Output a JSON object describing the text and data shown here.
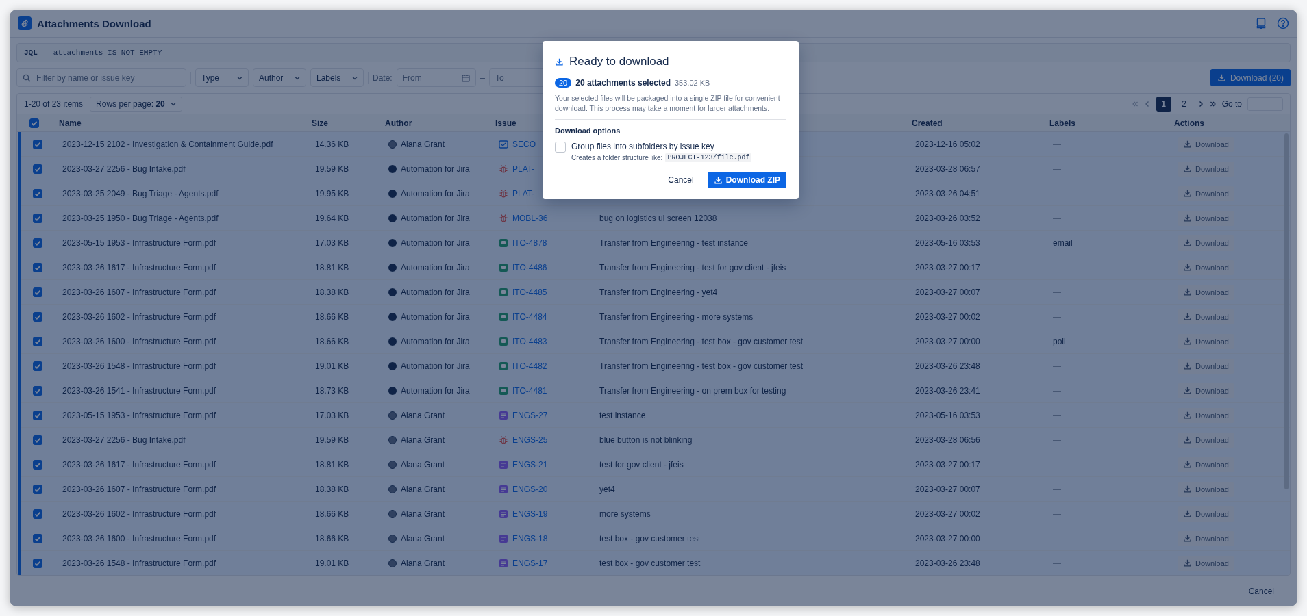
{
  "window": {
    "title": "Attachments Download"
  },
  "jql": {
    "label": "JQL",
    "query": "attachments IS NOT EMPTY"
  },
  "filters": {
    "search_placeholder": "Filter by name or issue key",
    "dropdowns": [
      "Type",
      "Author",
      "Labels"
    ],
    "date_label": "Date:",
    "from_placeholder": "From",
    "separator": "–",
    "to_placeholder": "To",
    "download_button": "Download (20)"
  },
  "pagination": {
    "count": "1-20 of 23 items",
    "rows_per_page": "Rows per page: **20**",
    "pages": [
      {
        "label": "1",
        "selected": true
      },
      {
        "label": "2",
        "selected": false
      }
    ],
    "goto_label": "Go to"
  },
  "table": {
    "select_all_checked": true,
    "columns": [
      "Name",
      "Size",
      "Author",
      "Issue",
      "Created",
      "Labels",
      "Actions"
    ],
    "rows": [
      {
        "checked": true,
        "name": "2023-12-15 2102 - Investigation & Containment Guide.pdf",
        "size": "14.36 KB",
        "author": {
          "name": "Alana Grant",
          "kind": "person"
        },
        "issue": {
          "key": "SECO",
          "kind": "task"
        },
        "created": "2023-12-16 05:02",
        "labels": "—",
        "action": "Download"
      },
      {
        "checked": true,
        "name": "2023-03-27 2256 - Bug Intake.pdf",
        "size": "19.59 KB",
        "author": {
          "name": "Automation for Jira",
          "kind": "bot"
        },
        "issue": {
          "key": "PLAT-",
          "kind": "bug"
        },
        "created": "2023-03-28 06:57",
        "labels": "—",
        "action": "Download"
      },
      {
        "checked": true,
        "name": "2023-03-25 2049 - Bug Triage - Agents.pdf",
        "size": "19.95 KB",
        "author": {
          "name": "Automation for Jira",
          "kind": "bot"
        },
        "issue": {
          "key": "PLAT-",
          "kind": "bug"
        },
        "created": "2023-03-26 04:51",
        "labels": "—",
        "action": "Download"
      },
      {
        "checked": true,
        "name": "2023-03-25 1950 - Bug Triage - Agents.pdf",
        "size": "19.64 KB",
        "author": {
          "name": "Automation for Jira",
          "kind": "bot"
        },
        "issue": {
          "key": "MOBL-36",
          "kind": "bug"
        },
        "summary": "bug on logistics ui screen 12038",
        "created": "2023-03-26 03:52",
        "labels": "—",
        "action": "Download"
      },
      {
        "checked": true,
        "name": "2023-05-15 1953 - Infrastructure Form.pdf",
        "size": "17.03 KB",
        "author": {
          "name": "Automation for Jira",
          "kind": "bot"
        },
        "issue": {
          "key": "ITO-4878",
          "kind": "request"
        },
        "summary": "Transfer from Engineering - test instance",
        "created": "2023-05-16 03:53",
        "labels": "email",
        "action": "Download"
      },
      {
        "checked": true,
        "name": "2023-03-26 1617 - Infrastructure Form.pdf",
        "size": "18.81 KB",
        "author": {
          "name": "Automation for Jira",
          "kind": "bot"
        },
        "issue": {
          "key": "ITO-4486",
          "kind": "request"
        },
        "summary": "Transfer from Engineering - test for gov client - jfeis",
        "created": "2023-03-27 00:17",
        "labels": "—",
        "action": "Download"
      },
      {
        "checked": true,
        "name": "2023-03-26 1607 - Infrastructure Form.pdf",
        "size": "18.38 KB",
        "author": {
          "name": "Automation for Jira",
          "kind": "bot"
        },
        "issue": {
          "key": "ITO-4485",
          "kind": "request"
        },
        "summary": "Transfer from Engineering - yet4",
        "created": "2023-03-27 00:07",
        "labels": "—",
        "action": "Download"
      },
      {
        "checked": true,
        "name": "2023-03-26 1602 - Infrastructure Form.pdf",
        "size": "18.66 KB",
        "author": {
          "name": "Automation for Jira",
          "kind": "bot"
        },
        "issue": {
          "key": "ITO-4484",
          "kind": "request"
        },
        "summary": "Transfer from Engineering - more systems",
        "created": "2023-03-27 00:02",
        "labels": "—",
        "action": "Download"
      },
      {
        "checked": true,
        "name": "2023-03-26 1600 - Infrastructure Form.pdf",
        "size": "18.66 KB",
        "author": {
          "name": "Automation for Jira",
          "kind": "bot"
        },
        "issue": {
          "key": "ITO-4483",
          "kind": "request"
        },
        "summary": "Transfer from Engineering - test box - gov customer test",
        "created": "2023-03-27 00:00",
        "labels": "poll",
        "action": "Download"
      },
      {
        "checked": true,
        "name": "2023-03-26 1548 - Infrastructure Form.pdf",
        "size": "19.01 KB",
        "author": {
          "name": "Automation for Jira",
          "kind": "bot"
        },
        "issue": {
          "key": "ITO-4482",
          "kind": "request"
        },
        "summary": "Transfer from Engineering - test box - gov customer test",
        "created": "2023-03-26 23:48",
        "labels": "—",
        "action": "Download"
      },
      {
        "checked": true,
        "name": "2023-03-26 1541 - Infrastructure Form.pdf",
        "size": "18.73 KB",
        "author": {
          "name": "Automation for Jira",
          "kind": "bot"
        },
        "issue": {
          "key": "ITO-4481",
          "kind": "request"
        },
        "summary": "Transfer from Engineering - on prem box for testing",
        "created": "2023-03-26 23:41",
        "labels": "—",
        "action": "Download"
      },
      {
        "checked": true,
        "name": "2023-05-15 1953 - Infrastructure Form.pdf",
        "size": "17.03 KB",
        "author": {
          "name": "Alana Grant",
          "kind": "person"
        },
        "issue": {
          "key": "ENGS-27",
          "kind": "feature"
        },
        "summary": "test instance",
        "created": "2023-05-16 03:53",
        "labels": "—",
        "action": "Download"
      },
      {
        "checked": true,
        "name": "2023-03-27 2256 - Bug Intake.pdf",
        "size": "19.59 KB",
        "author": {
          "name": "Alana Grant",
          "kind": "person"
        },
        "issue": {
          "key": "ENGS-25",
          "kind": "bug"
        },
        "summary": "blue button is not blinking",
        "created": "2023-03-28 06:56",
        "labels": "—",
        "action": "Download"
      },
      {
        "checked": true,
        "name": "2023-03-26 1617 - Infrastructure Form.pdf",
        "size": "18.81 KB",
        "author": {
          "name": "Alana Grant",
          "kind": "person"
        },
        "issue": {
          "key": "ENGS-21",
          "kind": "feature"
        },
        "summary": "test for gov client - jfeis",
        "created": "2023-03-27 00:17",
        "labels": "—",
        "action": "Download"
      },
      {
        "checked": true,
        "name": "2023-03-26 1607 - Infrastructure Form.pdf",
        "size": "18.38 KB",
        "author": {
          "name": "Alana Grant",
          "kind": "person"
        },
        "issue": {
          "key": "ENGS-20",
          "kind": "feature"
        },
        "summary": "yet4",
        "created": "2023-03-27 00:07",
        "labels": "—",
        "action": "Download"
      },
      {
        "checked": true,
        "name": "2023-03-26 1602 - Infrastructure Form.pdf",
        "size": "18.66 KB",
        "author": {
          "name": "Alana Grant",
          "kind": "person"
        },
        "issue": {
          "key": "ENGS-19",
          "kind": "feature"
        },
        "summary": "more systems",
        "created": "2023-03-27 00:02",
        "labels": "—",
        "action": "Download"
      },
      {
        "checked": true,
        "name": "2023-03-26 1600 - Infrastructure Form.pdf",
        "size": "18.66 KB",
        "author": {
          "name": "Alana Grant",
          "kind": "person"
        },
        "issue": {
          "key": "ENGS-18",
          "kind": "feature"
        },
        "summary": "test box - gov customer test",
        "created": "2023-03-27 00:00",
        "labels": "—",
        "action": "Download"
      },
      {
        "checked": true,
        "name": "2023-03-26 1548 - Infrastructure Form.pdf",
        "size": "19.01 KB",
        "author": {
          "name": "Alana Grant",
          "kind": "person"
        },
        "issue": {
          "key": "ENGS-17",
          "kind": "feature"
        },
        "summary": "test box - gov customer test",
        "created": "2023-03-26 23:48",
        "labels": "—",
        "action": "Download"
      }
    ]
  },
  "footer": {
    "cancel": "Cancel"
  },
  "modal": {
    "title": "Ready to download",
    "badge": "20",
    "selected_text": "20 attachments selected",
    "total_size": "353.02 KB",
    "description": "Your selected files will be packaged into a single ZIP file for convenient download. This process may take a moment for larger attachments.",
    "options_title": "Download options",
    "option": {
      "label": "Group files into subfolders by issue key",
      "checked": false,
      "hint": "Creates a folder structure like:",
      "example": "PROJECT-123/file.pdf"
    },
    "cancel": "Cancel",
    "confirm": "Download ZIP"
  }
}
